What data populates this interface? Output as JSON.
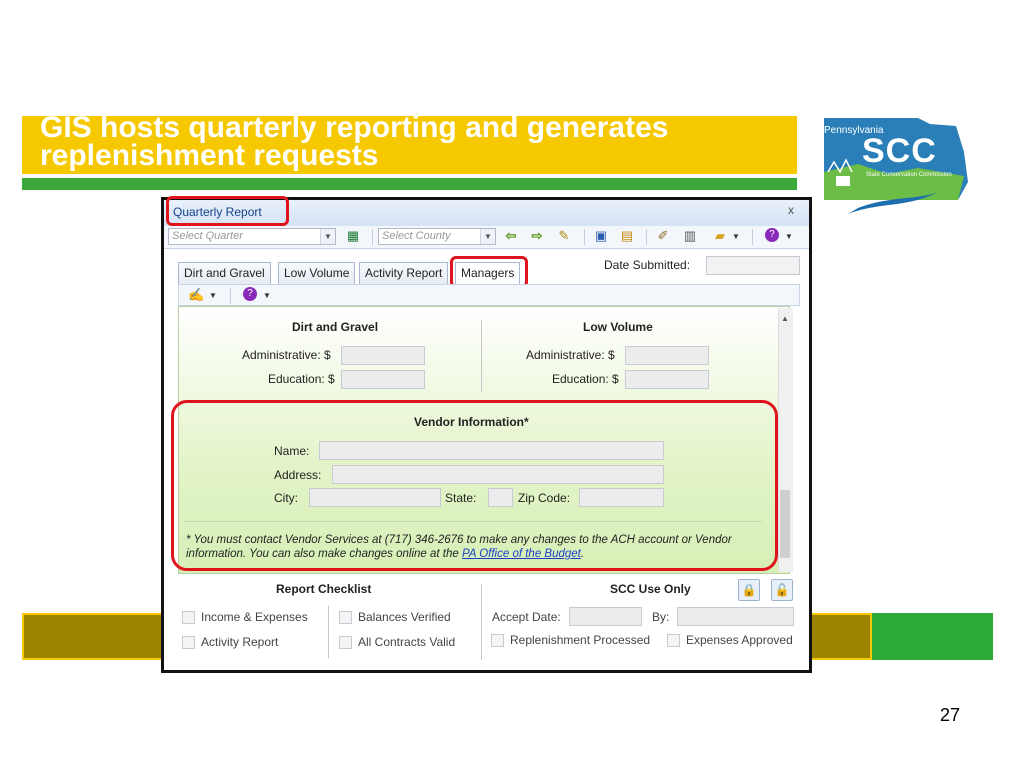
{
  "slide": {
    "title": "GIS hosts quarterly reporting and generates replenishment requests",
    "page_number": "27"
  },
  "logo": {
    "state_text": "Pennsylvania",
    "acronym": "SCC",
    "full_name": "State Conservation Commission"
  },
  "window": {
    "title": "Quarterly Report",
    "close": "x"
  },
  "toolbar": {
    "quarter_placeholder": "Select Quarter",
    "county_placeholder": "Select County",
    "icons": [
      "excel-icon",
      "back-arrow-icon",
      "forward-arrow-icon",
      "checklist-icon",
      "save-icon",
      "save-as-icon",
      "edit-icon",
      "print-icon",
      "folder-icon",
      "help-icon"
    ]
  },
  "tabs": [
    "Dirt and Gravel",
    "Low Volume",
    "Activity Report",
    "Managers"
  ],
  "active_tab": "Managers",
  "date_submitted": {
    "label": "Date Submitted:",
    "value": ""
  },
  "dirt_gravel": {
    "heading": "Dirt and Gravel",
    "administrative_label": "Administrative: $",
    "education_label": "Education: $"
  },
  "low_volume": {
    "heading": "Low Volume",
    "administrative_label": "Administrative: $",
    "education_label": "Education: $"
  },
  "vendor": {
    "heading": "Vendor Information*",
    "name_label": "Name:",
    "address_label": "Address:",
    "city_label": "City:",
    "state_label": "State:",
    "zip_label": "Zip Code:",
    "note_text": "* You must contact Vendor Services at (717) 346-2676 to make any changes to the ACH account or Vendor information. You can also make changes online at the ",
    "note_link": "PA Office of the Budget",
    "note_end": "."
  },
  "report_checklist": {
    "heading": "Report Checklist",
    "items": [
      "Income & Expenses",
      "Activity Report",
      "Balances Verified",
      "All Contracts Valid"
    ]
  },
  "scc_use": {
    "heading": "SCC Use Only",
    "accept_date_label": "Accept Date:",
    "by_label": "By:",
    "replenishment_label": "Replenishment Processed",
    "expenses_label": "Expenses Approved"
  },
  "colors": {
    "title_bar": "#f5c800",
    "accent_green": "#3aa83a",
    "highlight_red": "#e0141c",
    "panel_green": "#e3f4c8"
  }
}
